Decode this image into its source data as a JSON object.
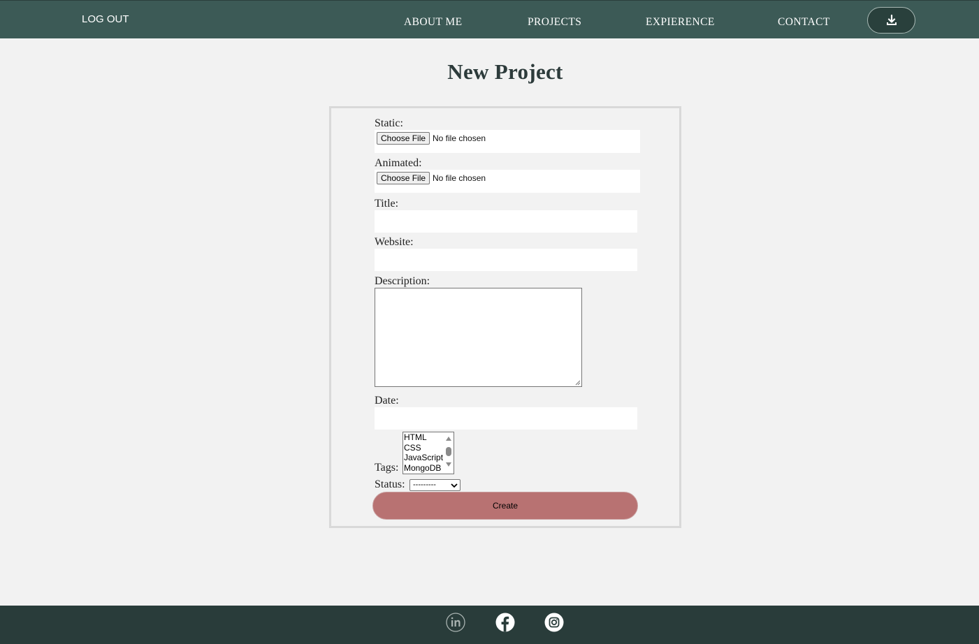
{
  "nav": {
    "logout": "LOG OUT",
    "links": [
      "ABOUT ME",
      "PROJECTS",
      "EXPIERENCE",
      "CONTACT"
    ],
    "download_icon": "download-icon"
  },
  "page": {
    "title": "New Project"
  },
  "form": {
    "static_label": "Static:",
    "animated_label": "Animated:",
    "choose_file": "Choose File",
    "no_file": "No file chosen",
    "title_label": "Title:",
    "title_value": "",
    "website_label": "Website:",
    "website_value": "",
    "description_label": "Description:",
    "description_value": "",
    "date_label": "Date:",
    "date_value": "",
    "tags_label": "Tags:",
    "tags_options": [
      "HTML",
      "CSS",
      "JavaScript",
      "MongoDB"
    ],
    "status_label": "Status:",
    "status_value": "---------",
    "create_button": "Create"
  },
  "footer": {
    "icons": [
      "linkedin-icon",
      "facebook-icon",
      "instagram-icon"
    ]
  },
  "colors": {
    "header_bg": "#3c5a56",
    "footer_bg": "#293c3a",
    "page_bg": "#f2f2f2",
    "create_button": "#b87272"
  }
}
